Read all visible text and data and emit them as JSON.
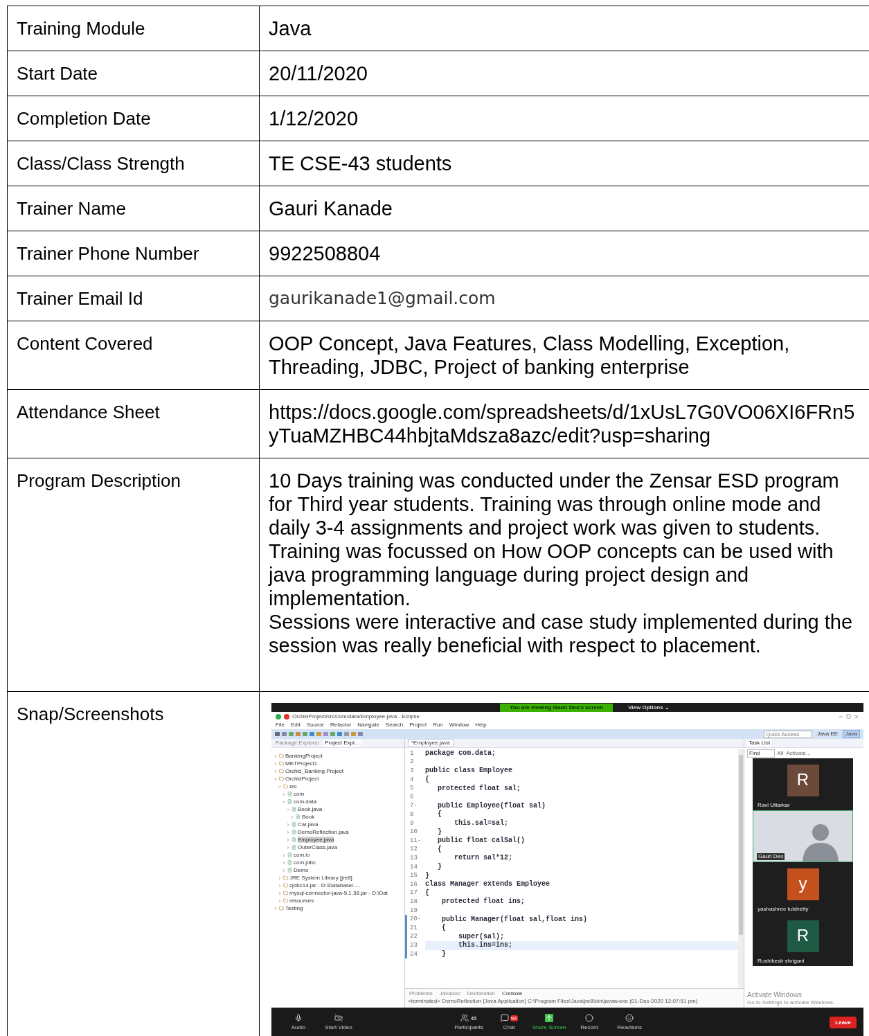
{
  "rows": [
    {
      "label": "Training Module",
      "value": [
        "Java"
      ]
    },
    {
      "label": "Start Date",
      "value": [
        "20/11/2020"
      ]
    },
    {
      "label": "Completion Date",
      "value": [
        "1/12/2020"
      ]
    },
    {
      "label": "Class/Class Strength",
      "value": [
        "TE CSE-43 students"
      ]
    },
    {
      "label": "Trainer Name",
      "value": [
        "Gauri Kanade"
      ]
    },
    {
      "label": "Trainer Phone Number",
      "value": [
        "9922508804"
      ]
    },
    {
      "label": "Trainer Email Id",
      "kind": "email",
      "value": [
        "gaurikanade1@gmail.com"
      ]
    },
    {
      "label": "Content Covered",
      "value": [
        "OOP Concept, Java Features, Class Modelling, Exception, Threading, JDBC, Project of banking enterprise"
      ]
    },
    {
      "label": "Attendance Sheet",
      "kind": "url",
      "value": [
        "https://docs.google.com/spreadsheets/d/1xUsL7G0VO06XI6FRn5yTuaMZHBC44hbjtaMdsza8azc/edit?usp=sharing"
      ]
    },
    {
      "label": "Program Description",
      "value": [
        "10 Days training was conducted under the Zensar ESD program for Third year students. Training was through online mode and daily 3-4 assignments and project work was given to students. Training was focussed on How OOP concepts can be used with java programming language during project design and implementation.",
        "Sessions were interactive and case study implemented during the session was really beneficial with respect to placement."
      ]
    },
    {
      "label": "Snap/Screenshots",
      "kind": "screenshot"
    }
  ],
  "screenshot": {
    "banner": {
      "notice": "You are viewing Gauri Deo's screen",
      "options": "View Options ⌄"
    },
    "window_title": "OrchidProject/src/com/data/Employee.java - Eclipse",
    "menu": [
      "File",
      "Edit",
      "Source",
      "Refactor",
      "Navigate",
      "Search",
      "Project",
      "Run",
      "Window",
      "Help"
    ],
    "quick_access": {
      "placeholder": "Quick Access"
    },
    "perspectives": [
      {
        "label": "Java EE",
        "selected": false
      },
      {
        "label": "Java",
        "selected": true
      }
    ],
    "explorer_tabs": [
      {
        "label": "Package Explorer",
        "selected": false
      },
      {
        "label": "Project Expl...",
        "selected": true
      }
    ],
    "tree": [
      {
        "label": "BankingProject",
        "expanded": false,
        "selected": false
      },
      {
        "label": "METProject1",
        "expanded": false,
        "selected": false
      },
      {
        "label": "Orchid_Banking Project",
        "expanded": false,
        "selected": false
      },
      {
        "label": "OrchidProject",
        "expanded": true,
        "selected": false,
        "children": [
          {
            "label": "src",
            "expanded": true,
            "selected": false,
            "children": [
              {
                "label": "com",
                "expanded": false,
                "selected": false
              },
              {
                "label": "com.data",
                "expanded": true,
                "selected": false,
                "children": [
                  {
                    "label": "Book.java",
                    "expanded": true,
                    "selected": false,
                    "children": [
                      {
                        "label": "Book",
                        "expanded": false,
                        "selected": false
                      }
                    ]
                  },
                  {
                    "label": "Car.java",
                    "expanded": false,
                    "selected": false
                  },
                  {
                    "label": "DemoReflection.java",
                    "expanded": false,
                    "selected": false
                  },
                  {
                    "label": "Employee.java",
                    "expanded": false,
                    "selected": true
                  },
                  {
                    "label": "OuterClass.java",
                    "expanded": false,
                    "selected": false
                  }
                ]
              },
              {
                "label": "com.io",
                "expanded": false,
                "selected": false
              },
              {
                "label": "com.jdbc",
                "expanded": false,
                "selected": false
              },
              {
                "label": "Demo",
                "expanded": false,
                "selected": false
              }
            ]
          },
          {
            "label": "JRE System Library [jre8]",
            "expanded": false,
            "selected": false
          },
          {
            "label": "cjdbc14.jar - D:\\Database\\ ...",
            "expanded": false,
            "selected": false
          },
          {
            "label": "mysql-connector-java-5.1.38.jar - D:\\Dat",
            "expanded": false,
            "selected": false
          },
          {
            "label": "resourses",
            "expanded": false,
            "selected": false
          }
        ]
      },
      {
        "label": "Testing",
        "expanded": false,
        "selected": false
      }
    ],
    "editor_tab": "*Employee.java",
    "code": [
      {
        "n": "1",
        "text": "package com.data;",
        "changed": false,
        "current": false
      },
      {
        "n": "2",
        "changed": false,
        "current": false
      },
      {
        "n": "3",
        "text": "public class Employee",
        "changed": false,
        "current": false
      },
      {
        "n": "4",
        "text": "{",
        "changed": false,
        "current": false
      },
      {
        "n": "5",
        "text": "   protected float sal;",
        "changed": false,
        "current": false
      },
      {
        "n": "6",
        "changed": false,
        "current": false
      },
      {
        "n": "7-",
        "text": "   public Employee(float sal)",
        "changed": false,
        "current": false
      },
      {
        "n": "8",
        "text": "   {",
        "changed": false,
        "current": false
      },
      {
        "n": "9",
        "text": "       this.sal=sal;",
        "changed": false,
        "current": false
      },
      {
        "n": "10",
        "text": "   }",
        "changed": false,
        "current": false
      },
      {
        "n": "11-",
        "text": "   public float calSal()",
        "changed": false,
        "current": false
      },
      {
        "n": "12",
        "text": "   {",
        "changed": false,
        "current": false
      },
      {
        "n": "13",
        "text": "       return sal*12;",
        "changed": false,
        "current": false
      },
      {
        "n": "14",
        "text": "   }",
        "changed": false,
        "current": false
      },
      {
        "n": "15",
        "text": "}",
        "changed": false,
        "current": false
      },
      {
        "n": "16",
        "text": "class Manager extends Employee",
        "changed": false,
        "current": false
      },
      {
        "n": "17",
        "text": "{",
        "changed": false,
        "current": false
      },
      {
        "n": "18",
        "text": "    protected float ins;",
        "changed": false,
        "current": false
      },
      {
        "n": "19",
        "changed": false,
        "current": false
      },
      {
        "n": "20-",
        "text": "    public Manager(float sal,float ins)",
        "changed": true,
        "current": false
      },
      {
        "n": "21",
        "text": "    {",
        "changed": true,
        "current": false
      },
      {
        "n": "22",
        "text": "        super(sal);",
        "changed": true,
        "current": false
      },
      {
        "n": "23",
        "text": "        this.ins=ins;",
        "changed": true,
        "current": true
      },
      {
        "n": "24",
        "text": "    }",
        "changed": true,
        "current": false
      }
    ],
    "console_tabs": [
      {
        "label": "Problems",
        "selected": false
      },
      {
        "label": "Javadoc",
        "selected": false
      },
      {
        "label": "Declaration",
        "selected": false
      },
      {
        "label": "Console",
        "selected": true
      }
    ],
    "console_line": "<terminated> DemoReflection [Java Application] C:\\Program Files\\Java\\jre8\\bin\\javaw.exe (01-Dec-2020 12:07:51 pm)",
    "task_list": {
      "title": "Task List",
      "find": "Find",
      "filters": [
        "All",
        "Activate..."
      ]
    },
    "participants_video": [
      {
        "kind": "avatar",
        "initial": "R",
        "color": "#6b4a3a",
        "name": "Ravi Uttarkar"
      },
      {
        "kind": "video",
        "name": "Gauri Deo"
      },
      {
        "kind": "avatar",
        "initial": "y",
        "color": "#c4501e",
        "name": "yashashree tulshetty"
      },
      {
        "kind": "avatar",
        "initial": "R",
        "color": "#1f5a45",
        "name": "Rushikesh shrigani"
      }
    ],
    "os_notice": [
      "Activate Windows",
      "Go to Settings to activate Windows."
    ],
    "controls": [
      {
        "kind": "audio",
        "label": "Audio"
      },
      {
        "kind": "video",
        "label": "Start Video"
      },
      {
        "kind": "participants",
        "label": "Participants",
        "count": "45"
      },
      {
        "kind": "chat",
        "label": "Chat",
        "count": "94"
      },
      {
        "kind": "share",
        "label": "Share Screen"
      },
      {
        "kind": "record",
        "label": "Record"
      },
      {
        "kind": "reactions",
        "label": "Reactions"
      }
    ],
    "leave": "Leave"
  }
}
